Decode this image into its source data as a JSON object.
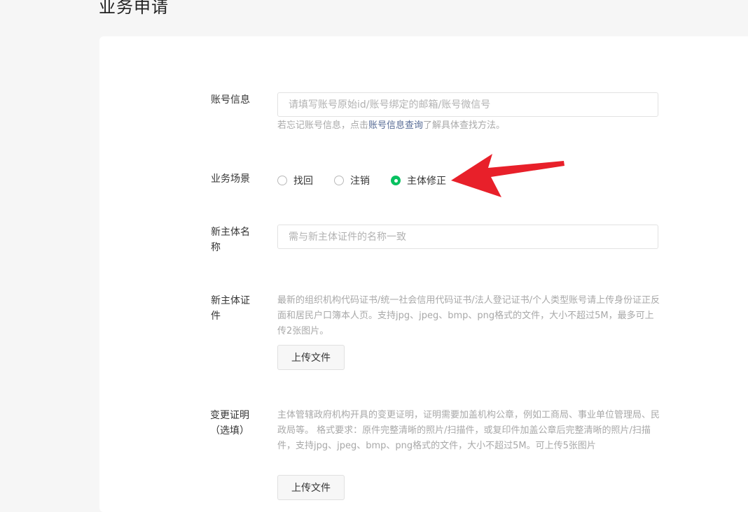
{
  "page": {
    "title": "业务申请"
  },
  "form": {
    "account": {
      "label": "账号信息",
      "placeholder": "请填写账号原始id/账号绑定的邮箱/账号微信号",
      "hint_prefix": "若忘记账号信息，点击",
      "hint_link": "账号信息查询",
      "hint_suffix": "了解具体查找方法。"
    },
    "scene": {
      "label": "业务场景",
      "options": [
        {
          "label": "找回",
          "checked": false
        },
        {
          "label": "注销",
          "checked": false
        },
        {
          "label": "主体修正",
          "checked": true
        }
      ]
    },
    "new_name": {
      "label": "新主体名称",
      "placeholder": "需与新主体证件的名称一致"
    },
    "new_cert": {
      "label": "新主体证件",
      "description": "最新的组织机构代码证书/统一社会信用代码证书/法人登记证书/个人类型账号请上传身份证正反面和居民户口簿本人页。支持jpg、jpeg、bmp、png格式的文件，大小不超过5M，最多可上传2张图片。",
      "upload_label": "上传文件"
    },
    "change_proof": {
      "label_line1": "变更证明",
      "label_line2": "（选填）",
      "description": "主体管辖政府机构开具的变更证明，证明需要加盖机构公章，例如工商局、事业单位管理局、民政局等。 格式要求：原件完整清晰的照片/扫描件，或复印件加盖公章后完整清晰的照片/扫描件，支持jpg、jpeg、bmp、png格式的文件，大小不超过5M。可上传5张图片",
      "upload_label": "上传文件"
    }
  },
  "colors": {
    "accent_green": "#07c160",
    "link": "#576b95",
    "arrow_red": "#e8202a"
  },
  "icons": {
    "annotation": "red-arrow-icon"
  }
}
